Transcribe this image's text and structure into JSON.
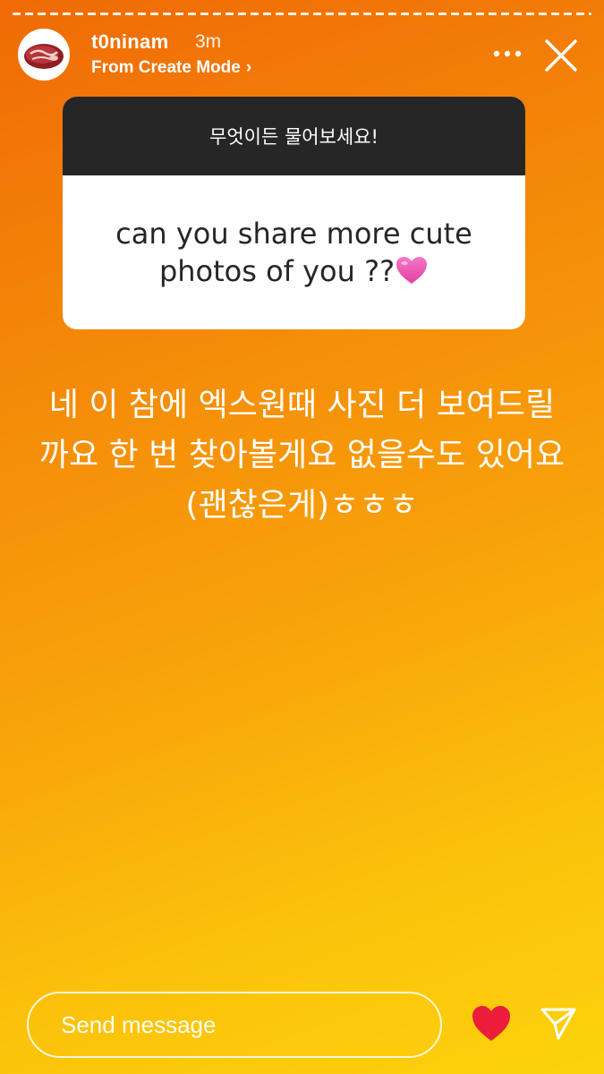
{
  "story": {
    "username": "t0ninam",
    "time_ago": "3m",
    "mode_link": "From Create Mode",
    "mode_chevron": "›"
  },
  "question_card": {
    "header": "무엇이든 물어보세요!",
    "question": "can you share more cute photos of you ??"
  },
  "reply": {
    "text": "네 이 참에 엑스원때 사진 더 보여드릴까요 한 번 찾아볼게요 없을수도 있어요(괜찮은게)ㅎㅎㅎ"
  },
  "footer": {
    "message_placeholder": "Send message"
  },
  "icons": {
    "avatar": "steak-avatar-icon",
    "more": "more-dots-icon",
    "close": "close-icon",
    "heart_emoji": "pink-heart-emoji-icon",
    "like": "heart-icon",
    "share": "send-icon"
  },
  "colors": {
    "gradient_top": "#f06a06",
    "gradient_bottom": "#fdd20c",
    "card_header": "#262626",
    "like_heart": "#ed1c3b",
    "emoji_heart": "#f15bb5"
  }
}
